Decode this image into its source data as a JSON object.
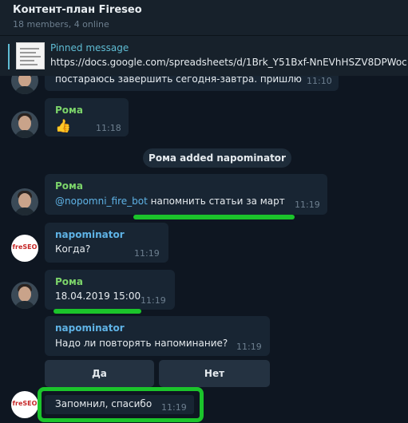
{
  "header": {
    "title": "Контент-план Fireseo",
    "subtitle": "18 members, 4 online"
  },
  "pinned": {
    "title": "Pinned message",
    "text": "https://docs.google.com/spreadsheets/d/1Brk_Y51Bxf-NnEVhHSZV8DPWoc"
  },
  "messages": {
    "m0": {
      "text": "постараюсь завершить сегодня-завтра. пришлю",
      "time": "11:10"
    },
    "m1": {
      "name": "Рома",
      "emoji": "👍",
      "time": "11:18"
    },
    "service": "Рома added napominator",
    "m2": {
      "name": "Рома",
      "mention": "@nopomni_fire_bot",
      "text": " напомнить статьи за март",
      "time": "11:19"
    },
    "m3": {
      "name": "napominator",
      "text": "Когда?",
      "time": "11:19",
      "avatar": "freSEO"
    },
    "m4": {
      "name": "Рома",
      "text": "18.04.2019 15:00",
      "time": "11:19"
    },
    "m5": {
      "name": "napominator",
      "text": "Надо ли повторять напоминание?",
      "time": "11:19"
    },
    "buttons": {
      "yes": "Да",
      "no": "Нет"
    },
    "m6": {
      "text": "Запомнил, спасибо",
      "time": "11:19",
      "avatar": "freSEO"
    }
  },
  "colors": {
    "background": "#0e1621",
    "bubble": "#182533",
    "highlight": "#1bc42b",
    "name_user": "#7cd46a",
    "name_bot": "#5fb3e6"
  }
}
